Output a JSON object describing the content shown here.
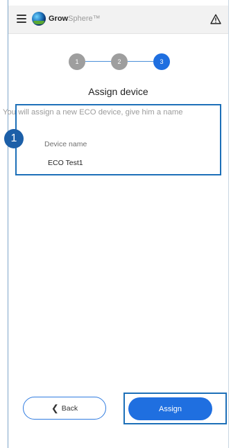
{
  "header": {
    "brand_bold": "Grow",
    "brand_light": "Sphere",
    "trademark": "™",
    "menu_icon": "hamburger-menu-icon",
    "alert_icon": "warning-triangle-icon"
  },
  "stepper": {
    "steps": [
      {
        "label": "1",
        "state": "done"
      },
      {
        "label": "2",
        "state": "done"
      },
      {
        "label": "3",
        "state": "active"
      }
    ],
    "colors": {
      "done": "#9e9e9e",
      "active": "#1f6fe0",
      "line": "#4a8fd8"
    }
  },
  "main": {
    "title": "Assign device",
    "subtitle": "You will assign a new ECO device, give him a name",
    "callout_number": "1",
    "field": {
      "label": "Device name",
      "value": "ECO Test1"
    }
  },
  "footer": {
    "back_label": "Back",
    "back_icon": "chevron-left-icon",
    "assign_label": "Assign"
  },
  "colors": {
    "accent": "#1f6fe0",
    "highlight": "#1c6fb8"
  }
}
